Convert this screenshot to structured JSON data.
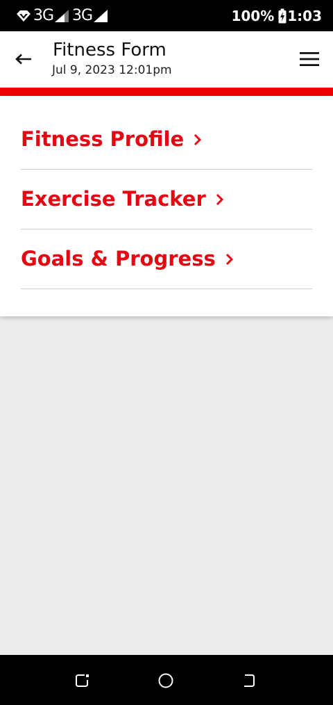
{
  "status_bar": {
    "network_1": "3G",
    "network_2": "3G",
    "battery": "100%",
    "time": "1:03"
  },
  "app_bar": {
    "title": "Fitness Form",
    "subtitle": "Jul 9, 2023 12:01pm",
    "accent_color": "#ee0000"
  },
  "menu": {
    "items": [
      {
        "label": "Fitness Profile"
      },
      {
        "label": "Exercise Tracker"
      },
      {
        "label": "Goals & Progress"
      }
    ]
  },
  "icons": {
    "back": "arrow-left-icon",
    "menu": "hamburger-icon",
    "chevron": "chevron-right-icon",
    "nav_recents": "recents-icon",
    "nav_home": "home-circle-icon",
    "nav_back": "back-icon"
  },
  "colors": {
    "item_text": "#e30613",
    "background": "#ececec"
  }
}
